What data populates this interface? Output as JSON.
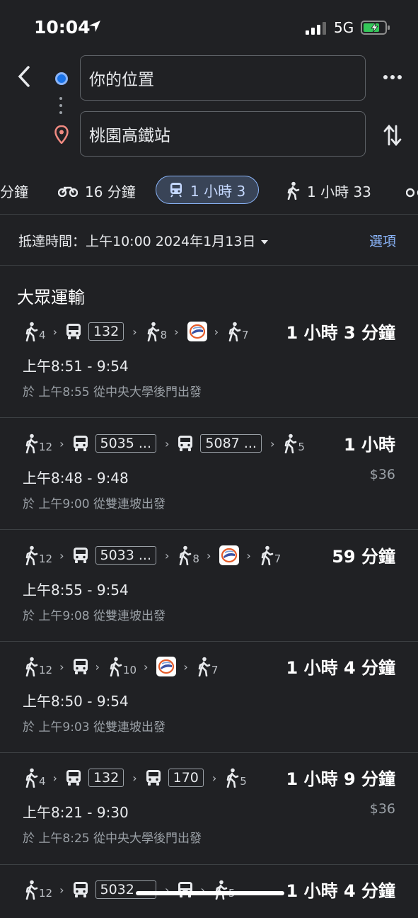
{
  "status_bar": {
    "time": "10:04",
    "network": "5G"
  },
  "search": {
    "origin": "你的位置",
    "destination": "桃園高鐵站"
  },
  "modes": [
    {
      "name": "car",
      "label": "分鐘"
    },
    {
      "name": "motorcycle",
      "label": "16 分鐘"
    },
    {
      "name": "transit",
      "label": "1 小時 3",
      "selected": true
    },
    {
      "name": "walk",
      "label": "1 小時 33"
    }
  ],
  "arrival": {
    "label": "抵達時間：上午10:00 2024年1月13日",
    "options": "選項"
  },
  "section_title": "大眾運輸",
  "routes": [
    {
      "steps": [
        {
          "type": "walk",
          "sub": "4"
        },
        {
          "type": "bus",
          "badge": "132"
        },
        {
          "type": "walk",
          "sub": "8"
        },
        {
          "type": "hsr"
        },
        {
          "type": "walk",
          "sub": "7"
        }
      ],
      "duration": "1 小時 3 分鐘",
      "times": "上午8:51 - 9:54",
      "price": "",
      "depart": "於 上午8:55 從中央大學後門出發"
    },
    {
      "steps": [
        {
          "type": "walk",
          "sub": "12"
        },
        {
          "type": "bus",
          "badge": "5035 ..."
        },
        {
          "type": "bus",
          "badge": "5087 ..."
        },
        {
          "type": "walk",
          "sub": "5"
        }
      ],
      "duration": "1 小時",
      "times": "上午8:48 - 9:48",
      "price": "$36",
      "depart": "於 上午9:00 從雙連坡出發"
    },
    {
      "steps": [
        {
          "type": "walk",
          "sub": "12"
        },
        {
          "type": "bus",
          "badge": "5033 ..."
        },
        {
          "type": "walk",
          "sub": "8"
        },
        {
          "type": "hsr"
        },
        {
          "type": "walk",
          "sub": "7"
        }
      ],
      "duration": "59 分鐘",
      "times": "上午8:55 - 9:54",
      "price": "",
      "depart": "於 上午9:08 從雙連坡出發"
    },
    {
      "steps": [
        {
          "type": "walk",
          "sub": "12"
        },
        {
          "type": "bus"
        },
        {
          "type": "walk",
          "sub": "10"
        },
        {
          "type": "hsr"
        },
        {
          "type": "walk",
          "sub": "7"
        }
      ],
      "duration": "1 小時 4 分鐘",
      "times": "上午8:50 - 9:54",
      "price": "",
      "depart": "於 上午9:03 從雙連坡出發"
    },
    {
      "steps": [
        {
          "type": "walk",
          "sub": "4"
        },
        {
          "type": "bus",
          "badge": "132"
        },
        {
          "type": "bus",
          "badge": "170"
        },
        {
          "type": "walk",
          "sub": "5"
        }
      ],
      "duration": "1 小時 9 分鐘",
      "times": "上午8:21 - 9:30",
      "price": "$36",
      "depart": "於 上午8:25 從中央大學後門出發"
    },
    {
      "steps": [
        {
          "type": "walk",
          "sub": "12"
        },
        {
          "type": "bus",
          "badge": "5032 ..."
        },
        {
          "type": "bus"
        },
        {
          "type": "walk",
          "sub": "5"
        }
      ],
      "duration": "1 小時 4 分鐘",
      "times": "",
      "price": "",
      "depart": ""
    }
  ],
  "colors": {
    "background": "#202124",
    "accent": "#8ab4f8",
    "origin_dot": "#1a73e8",
    "pin": "#f28b82"
  }
}
